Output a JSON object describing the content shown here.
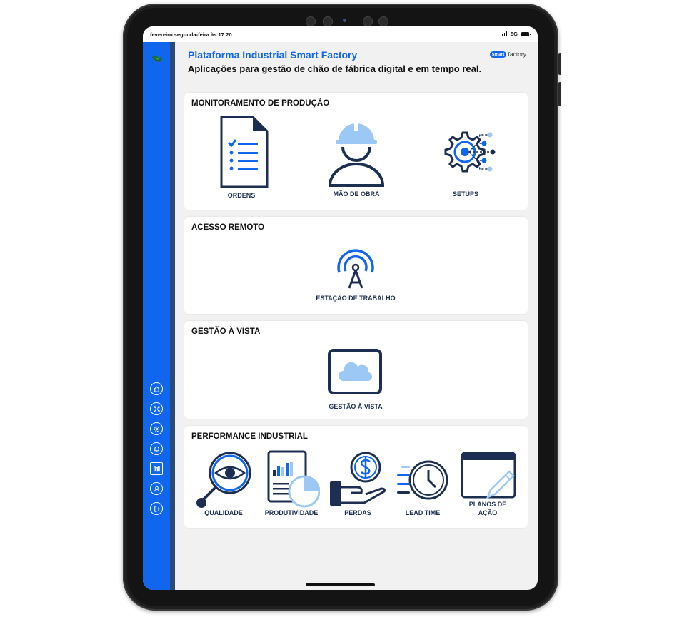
{
  "status_bar": {
    "time": "fevereiro segunda-feira às 17:20",
    "network": "5G"
  },
  "header": {
    "title": "Plataforma Industrial Smart Factory",
    "subtitle": "Aplicações para gestão de chão de fábrica digital e em tempo real.",
    "brand_pill": "smart",
    "brand_word": "factory"
  },
  "sections": {
    "monitoramento": {
      "title": "MONITORAMENTO DE PRODUÇÃO",
      "apps": [
        "ORDENS",
        "MÃO DE OBRA",
        "SETUPS"
      ]
    },
    "acesso": {
      "title": "ACESSO REMOTO",
      "apps": [
        "ESTAÇÃO DE TRABALHO"
      ]
    },
    "gestao": {
      "title": "GESTÃO À VISTA",
      "apps": [
        "GESTÃO À VISTA"
      ]
    },
    "performance": {
      "title": "PERFORMANCE INDUSTRIAL",
      "apps": [
        "QUALIDADE",
        "PRODUTIVIDADE",
        "PERDAS",
        "LEAD TIME",
        "PLANOS DE",
        "AÇÃO"
      ]
    }
  },
  "sidebar": {
    "items": [
      "home-icon",
      "fullscreen-icon",
      "settings-icon",
      "bell-icon",
      "factory-icon",
      "user-icon",
      "logout-icon"
    ]
  },
  "colors": {
    "accent": "#1166ee",
    "dark_navy": "#1c2e52",
    "light_blue": "#9cc8f5"
  }
}
